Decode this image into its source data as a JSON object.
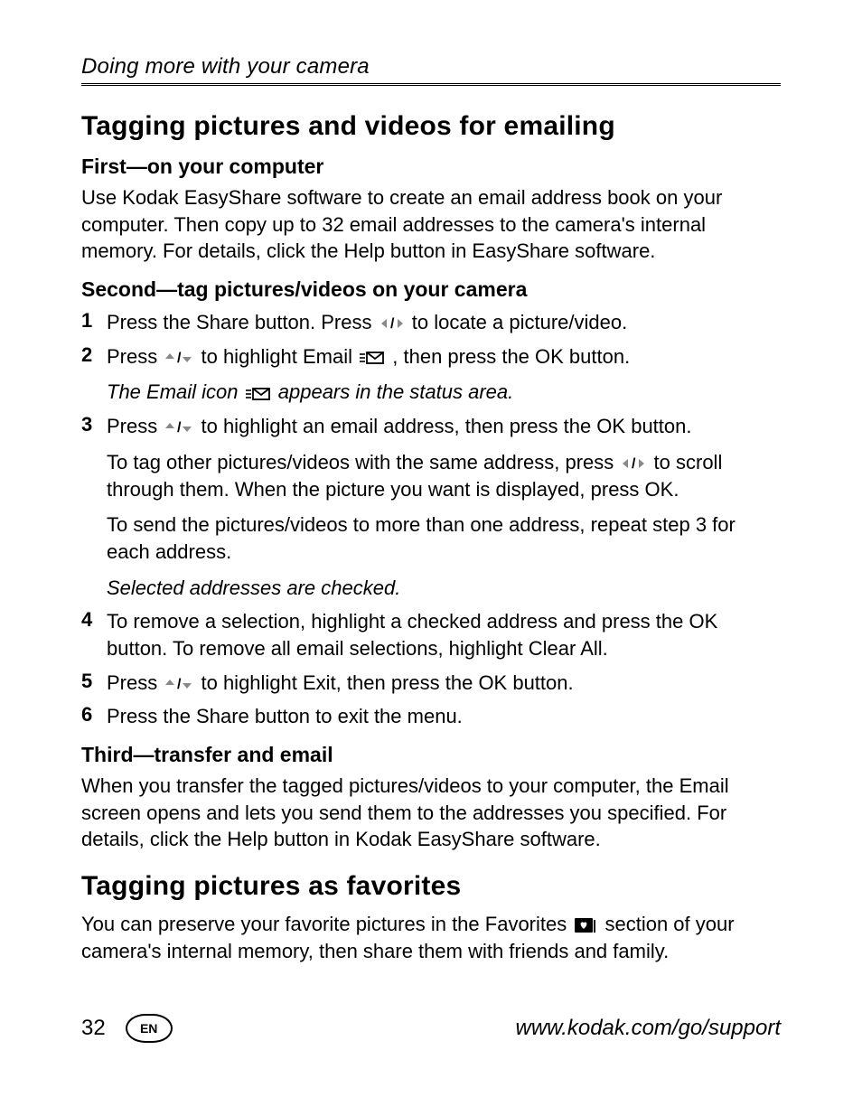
{
  "running_head": "Doing more with your camera",
  "h2_tagging_email": "Tagging pictures and videos for emailing",
  "h3_first": "First—on your computer",
  "p_first": "Use Kodak EasyShare software to create an email address book on your computer. Then copy up to 32 email addresses to the camera's internal memory. For details, click the Help button in EasyShare software.",
  "h3_second": "Second—tag pictures/videos on your camera",
  "steps": {
    "s1": {
      "num": "1",
      "a": "Press the Share button. Press ",
      "b": " to locate a picture/video."
    },
    "s2": {
      "num": "2",
      "a": "Press ",
      "b": " to highlight Email ",
      "c": ", then press the OK button.",
      "note_a": "The Email icon ",
      "note_b": " appears in the status area."
    },
    "s3": {
      "num": "3",
      "a": "Press ",
      "b": " to highlight an email address, then press the OK button.",
      "p2a": "To tag other pictures/videos with the same address, press ",
      "p2b": " to scroll through them. When the picture you want is displayed, press OK.",
      "p3": "To send the pictures/videos to more than one address, repeat step 3 for each address.",
      "note": "Selected addresses are checked."
    },
    "s4": {
      "num": "4",
      "t": "To remove a selection, highlight a checked address and press the OK button. To remove all email selections, highlight Clear All."
    },
    "s5": {
      "num": "5",
      "a": "Press ",
      "b": " to highlight Exit, then press the OK button."
    },
    "s6": {
      "num": "6",
      "t": "Press the Share button to exit the menu."
    }
  },
  "h3_third": "Third—transfer and email",
  "p_third": "When you transfer the tagged pictures/videos to your computer, the Email screen opens and lets you send them to the addresses you specified. For details, click the Help button in Kodak EasyShare software.",
  "h2_favorites": "Tagging pictures as favorites",
  "p_fav_a": "You can preserve your favorite pictures in the Favorites ",
  "p_fav_b": " section of your camera's internal memory, then share them with friends and family.",
  "footer": {
    "page": "32",
    "lang": "EN",
    "url": "www.kodak.com/go/support"
  }
}
